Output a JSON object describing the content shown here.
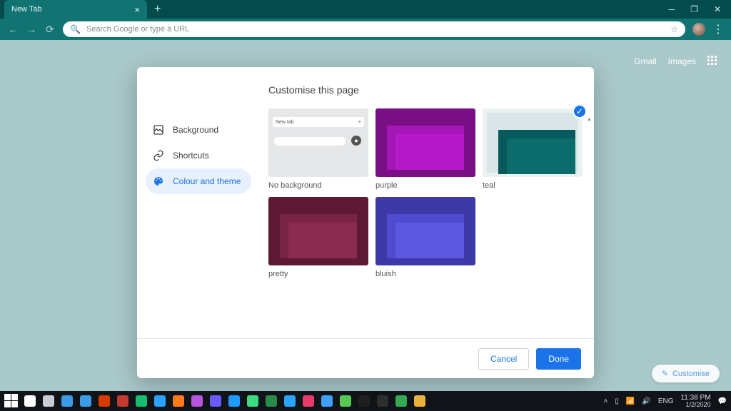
{
  "titlebar": {
    "tab_title": "New Tab"
  },
  "toolbar": {
    "omnibox_placeholder": "Search Google or type a URL"
  },
  "ntp": {
    "gmail": "Gmail",
    "images": "Images",
    "customise_pill": "Customise"
  },
  "dialog": {
    "title": "Customise this page",
    "sidebar": {
      "background": "Background",
      "shortcuts": "Shortcuts",
      "colour_theme": "Colour and theme"
    },
    "themes": [
      {
        "label": "No background",
        "kind": "none",
        "selected": false
      },
      {
        "label": "purple",
        "kind": "color",
        "bg": "#7a0f85",
        "t1": "#a516b6",
        "t2": "#b51ac8",
        "selected": false
      },
      {
        "label": "teal",
        "kind": "teal",
        "bg": "#0e7a7a",
        "t1": "#065a59",
        "t2": "#0c6c6c",
        "selected": true
      },
      {
        "label": "pretty",
        "kind": "color",
        "bg": "#5f1a33",
        "t1": "#7a2444",
        "t2": "#8c2b50",
        "selected": false
      },
      {
        "label": "bluish",
        "kind": "color",
        "bg": "#3d3aa8",
        "t1": "#4e4bcf",
        "t2": "#5c59e0",
        "selected": false
      }
    ],
    "nb_tab_label": "New tab",
    "cancel": "Cancel",
    "done": "Done"
  },
  "tray": {
    "lang": "ENG",
    "time": "11:38 PM",
    "date": "1/2/2020"
  },
  "taskbar_icons": [
    "#ffffff",
    "#c8cdd2",
    "#3b9be6",
    "#3b9be6",
    "#d83b01",
    "#c43a2f",
    "#1abc6f",
    "#2aa3ff",
    "#ff7a18",
    "#b656e0",
    "#6b5bff",
    "#1f9bff",
    "#3edc81",
    "#2a8a4a",
    "#2aa3ff",
    "#e83d6a",
    "#3fa1ff",
    "#56c854",
    "#1f1f1f",
    "#2e2e2e",
    "#36a853",
    "#e8b23a"
  ]
}
